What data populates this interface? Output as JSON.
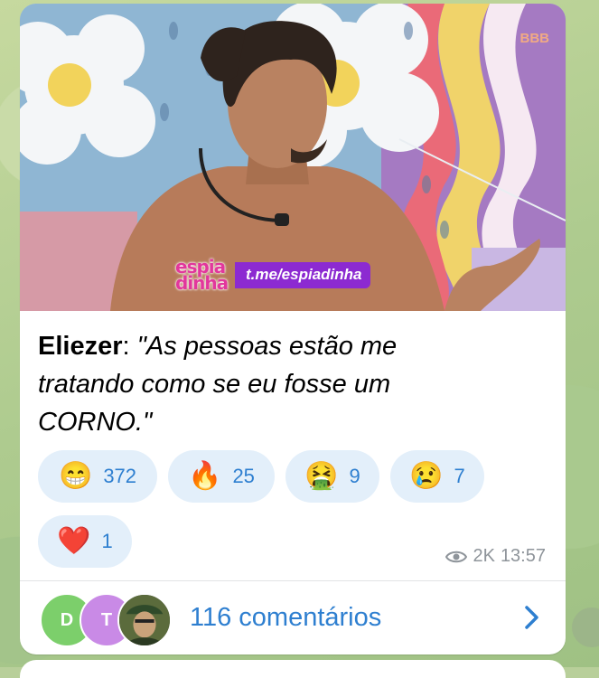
{
  "post": {
    "speaker": "Eliezer",
    "separator": ": ",
    "quote_line1": "\"As pessoas estão me",
    "quote_line2": "tratando como se eu fosse um",
    "quote_line3": "CORNO.\""
  },
  "image": {
    "badge": "BBB",
    "logo_text_top": "espia",
    "logo_text_bottom": "dinha",
    "link_text": "t.me/espiadinha"
  },
  "reactions": [
    {
      "icon": "grinning-face-icon",
      "emoji": "😁",
      "count": "372"
    },
    {
      "icon": "fire-icon",
      "emoji": "🔥",
      "count": "25"
    },
    {
      "icon": "vomiting-face-icon",
      "emoji": "🤮",
      "count": "9"
    },
    {
      "icon": "crying-face-icon",
      "emoji": "😢",
      "count": "7"
    },
    {
      "icon": "red-heart-icon",
      "emoji": "❤️",
      "count": "1"
    }
  ],
  "meta": {
    "views": "2K",
    "time": "13:57"
  },
  "comments": {
    "avatars": [
      {
        "initial": "D",
        "color": "#7ccf6b"
      },
      {
        "initial": "T",
        "color": "#c98ae6"
      }
    ],
    "label": "116 comentários",
    "accent": "#2e7fd0"
  }
}
